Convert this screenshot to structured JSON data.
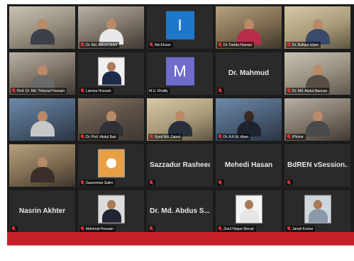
{
  "meeting": {
    "row1": {
      "tile1_label": "",
      "tile2_label": "Dr. Md. Alimul Islam",
      "tile3_initial": "I",
      "tile3_label": "Ifat Ehsan",
      "tile4_label": "Dr. Farida Hassan",
      "tile5_label": "Dr. Rafiqul Islam"
    },
    "row2": {
      "tile1_label": "Prof. Dr. Md. Tofazzal Hossain",
      "tile2_label": "Lamisa Hossain",
      "tile3_initial": "M",
      "tile3_label": "M.U. Khalily",
      "tile4_name": "Dr. Mahmud",
      "tile4_label": "",
      "tile5_label": "Dr. Md. Abdul Mannan"
    },
    "row3": {
      "tile1_label": "",
      "tile2_label": "Dr. Prof. Abdul Bari",
      "tile3_label": "Syed Md. Zainul",
      "tile4_label": "Dr. A.K.M. Alam",
      "tile5_label": "iPhone"
    },
    "row4": {
      "tile1_label": "",
      "tile2_label": "Gazeeman Salim",
      "tile3_name": "Sazzadur Rasheed",
      "tile3_label": "",
      "tile4_name": "Mehedi Hasan",
      "tile4_label": "",
      "tile5_name": "BdREN vSession...",
      "tile5_label": ""
    },
    "row5": {
      "tile1_name": "Nasrin Akhter",
      "tile1_label": "",
      "tile2_label": "Mahmud Hossain",
      "tile3_name": "Dr. Md. Abdus S...",
      "tile3_label": "",
      "tile4_label": "Ziaul Haque Murad",
      "tile5_label": "Janak Kumar"
    }
  },
  "colors": {
    "avatar_blue": "#1f77c9",
    "avatar_purple": "#6f6ccc",
    "mute_red": "#e03131",
    "footer_red": "#c8202a"
  },
  "icons": {
    "muted_mic": "microphone-muted-icon"
  }
}
